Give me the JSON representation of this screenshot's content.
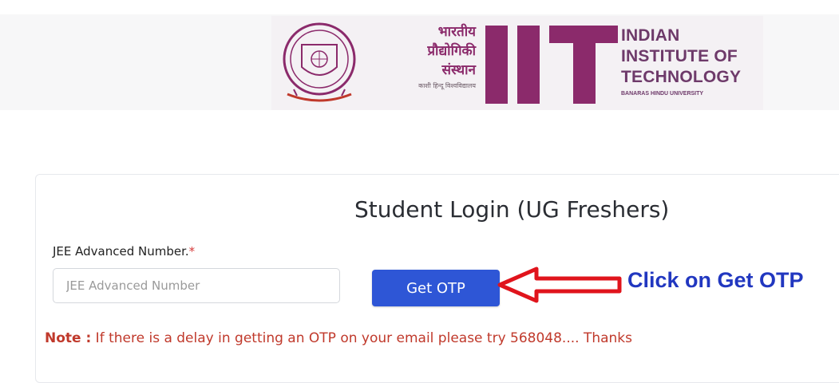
{
  "logo": {
    "hindi_lines": [
      "भारतीय",
      "प्रौद्योगिकी",
      "संस्थान"
    ],
    "hindi_sub": "काशी हिन्दू विश्वविद्यालय",
    "english_lines": [
      "INDIAN",
      "INSTITUTE OF",
      "TECHNOLOGY"
    ],
    "english_sub": "BANARAS HINDU UNIVERSITY",
    "big_letters": "IIT",
    "brand_color": "#8b2a6b"
  },
  "form": {
    "title": "Student Login (UG Freshers)",
    "label": "JEE Advanced Number.",
    "required_mark": "*",
    "input_placeholder": "JEE Advanced Number",
    "button_label": "Get OTP"
  },
  "annotation": {
    "callout": "Click on Get OTP",
    "arrow_color": "#e0141c",
    "callout_color": "#2137c0"
  },
  "note": {
    "prefix": "Note :",
    "text": " If there is a delay in getting an OTP on your email please try 568048.... Thanks"
  }
}
